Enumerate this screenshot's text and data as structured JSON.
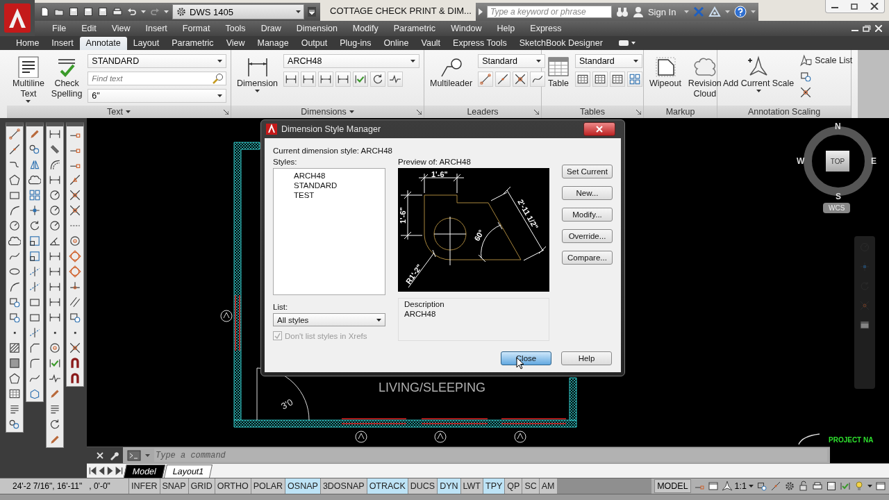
{
  "title_bar": {
    "workspace": "DWS 1405",
    "document_title": "COTTAGE CHECK PRINT & DIM...",
    "search": {
      "placeholder": "Type a keyword or phrase"
    },
    "sign_in": "Sign In"
  },
  "menu_bar": [
    "File",
    "Edit",
    "View",
    "Insert",
    "Format",
    "Tools",
    "Draw",
    "Dimension",
    "Modify",
    "Parametric",
    "Window",
    "Help",
    "Express"
  ],
  "ribbon_tabs": [
    {
      "label": "Home",
      "selected": false
    },
    {
      "label": "Insert",
      "selected": false
    },
    {
      "label": "Annotate",
      "selected": true
    },
    {
      "label": "Layout",
      "selected": false
    },
    {
      "label": "Parametric",
      "selected": false
    },
    {
      "label": "View",
      "selected": false
    },
    {
      "label": "Manage",
      "selected": false
    },
    {
      "label": "Output",
      "selected": false
    },
    {
      "label": "Plug-ins",
      "selected": false
    },
    {
      "label": "Online",
      "selected": false
    },
    {
      "label": "Vault",
      "selected": false
    },
    {
      "label": "Express Tools",
      "selected": false
    },
    {
      "label": "SketchBook Designer",
      "selected": false
    }
  ],
  "ribbon_panels": [
    {
      "title": "Text",
      "menu": true,
      "launcher": true,
      "large": [
        {
          "label": "Multiline Text",
          "dropdown": true
        },
        {
          "label": "Check Spelling",
          "dropdown": false
        }
      ],
      "fields": [
        {
          "kind": "combo",
          "value": "STANDARD"
        },
        {
          "kind": "search",
          "placeholder": "Find text"
        },
        {
          "kind": "combo",
          "value": "6\""
        }
      ]
    },
    {
      "title": "Dimensions",
      "menu": true,
      "launcher": true,
      "large": [
        {
          "label": "Dimension",
          "dropdown": true
        }
      ],
      "fields": [
        {
          "kind": "combo",
          "value": "ARCH48"
        }
      ]
    },
    {
      "title": "Leaders",
      "menu": false,
      "launcher": true,
      "large": [
        {
          "label": "Multileader",
          "dropdown": false
        }
      ],
      "fields": [
        {
          "kind": "combo",
          "value": "Standard"
        }
      ]
    },
    {
      "title": "Tables",
      "menu": false,
      "launcher": true,
      "large": [
        {
          "label": "Table",
          "dropdown": false
        }
      ],
      "fields": [
        {
          "kind": "combo",
          "value": "Standard"
        }
      ]
    },
    {
      "title": "Markup",
      "menu": false,
      "launcher": false,
      "large": [
        {
          "label": "Wipeout",
          "dropdown": false
        },
        {
          "label": "Revision Cloud",
          "dropdown": false
        }
      ]
    },
    {
      "title": "Annotation Scaling",
      "menu": false,
      "launcher": false,
      "large": [
        {
          "label": "Add Current Scale",
          "dropdown": true
        }
      ],
      "small": [
        {
          "label": "Scale List"
        }
      ]
    }
  ],
  "drawing": {
    "room_label": "LIVING/SLEEPING",
    "door_label": "3'0",
    "corner_text": "PROJECT NA"
  },
  "viewcube": {
    "north": "N",
    "south": "S",
    "east": "E",
    "west": "W",
    "face": "TOP",
    "coordinate_system": "WCS"
  },
  "dialog": {
    "title": "Dimension Style Manager",
    "current_style": "Current dimension style: ARCH48",
    "styles_label": "Styles:",
    "styles": [
      {
        "name": "ARCH48",
        "selected": false
      },
      {
        "name": "STANDARD",
        "selected": false
      },
      {
        "name": "TEST",
        "selected": false
      }
    ],
    "preview_label": "Preview of: ARCH48",
    "preview_labels": [
      "1'-6\"",
      "1'-6\"",
      "2'-11 1/2\"",
      "60°",
      "R1'-2\""
    ],
    "side_buttons": [
      {
        "label": "Set Current",
        "focused": false
      },
      {
        "label": "New...",
        "focused": false
      },
      {
        "label": "Modify...",
        "focused": false
      },
      {
        "label": "Override...",
        "focused": false
      },
      {
        "label": "Compare...",
        "focused": false
      }
    ],
    "list_label": "List:",
    "list_value": "All styles",
    "xrefs": {
      "label": "Don't list styles in Xrefs",
      "checked": true,
      "disabled": true
    },
    "description_label": "Description",
    "description": "ARCH48",
    "bottom_buttons": [
      {
        "label": "Close",
        "focused": true
      },
      {
        "label": "Help",
        "focused": false
      }
    ]
  },
  "command_line": {
    "placeholder": "Type a command"
  },
  "layout_tabs": [
    {
      "label": "Model",
      "selected": true
    },
    {
      "label": "Layout1",
      "selected": false
    }
  ],
  "status_bar": {
    "coordinates": "24'-2 7/16\", 16'-11\"   , 0'-0\"",
    "toggles": [
      {
        "label": "INFER",
        "on": false
      },
      {
        "label": "SNAP",
        "on": false
      },
      {
        "label": "GRID",
        "on": false
      },
      {
        "label": "ORTHO",
        "on": false
      },
      {
        "label": "POLAR",
        "on": false
      },
      {
        "label": "OSNAP",
        "on": true
      },
      {
        "label": "3DOSNAP",
        "on": false
      },
      {
        "label": "OTRACK",
        "on": true
      },
      {
        "label": "DUCS",
        "on": false
      },
      {
        "label": "DYN",
        "on": true
      },
      {
        "label": "LWT",
        "on": false
      },
      {
        "label": "TPY",
        "on": true
      },
      {
        "label": "QP",
        "on": false
      },
      {
        "label": "SC",
        "on": false
      },
      {
        "label": "AM",
        "on": false
      }
    ],
    "space": "MODEL",
    "annotation_scale": "1:1"
  }
}
